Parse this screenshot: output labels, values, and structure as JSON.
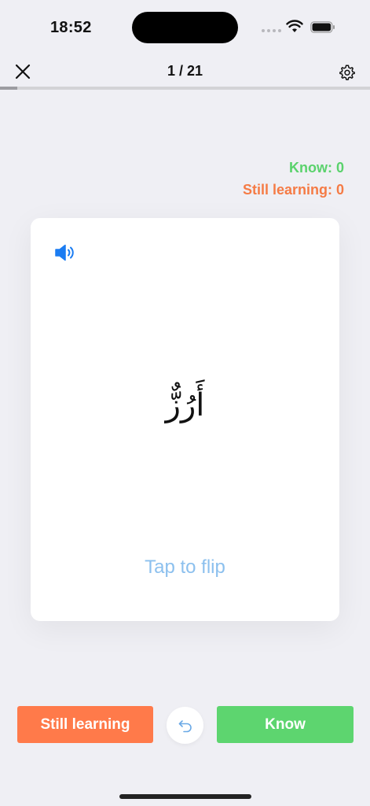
{
  "status_bar": {
    "time": "18:52"
  },
  "nav": {
    "progress_text": "1 / 21",
    "progress": {
      "current": 1,
      "total": 21
    }
  },
  "counters": {
    "know": "Know: 0",
    "still_learning": "Still learning: 0"
  },
  "card": {
    "term": "أَرُزٌّ",
    "flip_hint": "Tap to flip"
  },
  "actions": {
    "still_learning_label": "Still learning",
    "know_label": "Know"
  },
  "colors": {
    "know": "#5ad26c",
    "still_learning": "#f57b45",
    "accent_blue": "#1a7cf2",
    "flip_hint": "#8cc0ee"
  },
  "icons": {
    "close": "close-icon",
    "settings": "gear-icon",
    "speaker": "speaker-icon",
    "undo": "undo-icon"
  }
}
